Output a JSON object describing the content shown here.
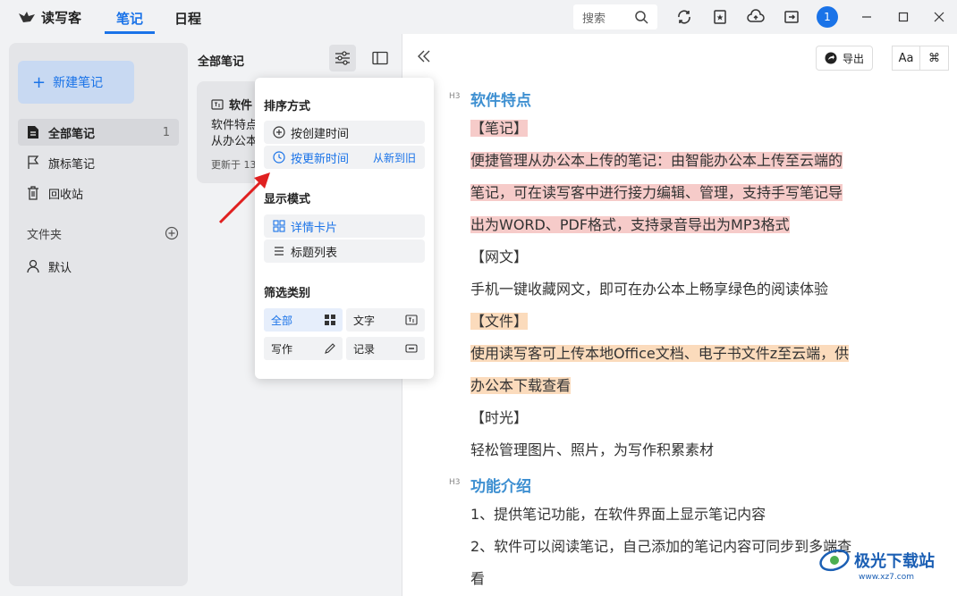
{
  "app": {
    "name": "读写客"
  },
  "nav": {
    "tabs": [
      {
        "label": "笔记"
      },
      {
        "label": "日程"
      }
    ]
  },
  "search": {
    "placeholder": "搜索"
  },
  "user": {
    "badge": "1"
  },
  "sidebar": {
    "new_button": "新建笔记",
    "items": [
      {
        "label": "全部笔记",
        "count": "1"
      },
      {
        "label": "旗标笔记"
      },
      {
        "label": "回收站"
      }
    ],
    "folder_label": "文件夹",
    "folders": [
      {
        "label": "默认"
      }
    ]
  },
  "notes_list": {
    "title": "全部笔记",
    "card": {
      "title": "软件",
      "body_line1": "软件特点",
      "body_line2": "从办公本",
      "date": "更新于 13"
    }
  },
  "popover": {
    "sort_title": "排序方式",
    "sort_options": [
      {
        "label": "按创建时间"
      },
      {
        "label": "按更新时间",
        "extra": "从新到旧"
      }
    ],
    "display_title": "显示模式",
    "display_options": [
      {
        "label": "详情卡片"
      },
      {
        "label": "标题列表"
      }
    ],
    "filter_title": "筛选类别",
    "filters": [
      {
        "label": "全部"
      },
      {
        "label": "文字"
      },
      {
        "label": "写作"
      },
      {
        "label": "记录"
      }
    ]
  },
  "toolbar": {
    "export_label": "导出",
    "font_label": "Aa",
    "cmd_label": "⌘",
    "h3_tag": "H3"
  },
  "doc": {
    "h1": "软件特点",
    "p1": "【笔记】",
    "p2": "便捷管理从办公本上传的笔记：由智能办公本上传至云端的",
    "p3": "笔记，可在读写客中进行接力编辑、管理，支持手写笔记导",
    "p4": "出为WORD、PDF格式，支持录音导出为MP3格式",
    "p5": "【网文】",
    "p6": "手机一键收藏网文，即可在办公本上畅享绿色的阅读体验",
    "p7": "【文件】",
    "p8": "使用读写客可上传本地Office文档、电子书文件z至云端，供",
    "p9": "办公本下载查看",
    "p10": "【时光】",
    "p11": "轻松管理图片、照片，为写作积累素材",
    "h2": "功能介绍",
    "p12": "1、提供笔记功能，在软件界面上显示笔记内容",
    "p13": "2、软件可以阅读笔记，自己添加的笔记内容可同步到多端查",
    "p14": "看"
  },
  "watermark": {
    "text": "极光下载站",
    "url": "www.xz7.com"
  },
  "colors": {
    "accent": "#1a73e8",
    "heading": "#3d8fd1",
    "highlight_red": "#f6cbc9",
    "highlight_orange": "#fbdbbc"
  }
}
